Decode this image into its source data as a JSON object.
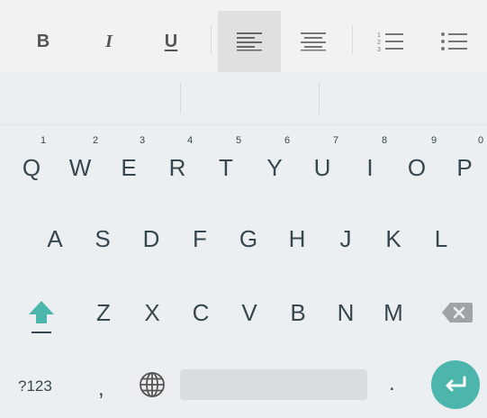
{
  "toolbar": {
    "bold_label": "B",
    "italic_label": "I",
    "underline_label": "U",
    "active_align": "left",
    "accent_active_bg": "#E0E0E0"
  },
  "suggestions": [
    "",
    "",
    ""
  ],
  "keyboard": {
    "row1": [
      {
        "key": "Q",
        "hint": "1"
      },
      {
        "key": "W",
        "hint": "2"
      },
      {
        "key": "E",
        "hint": "3"
      },
      {
        "key": "R",
        "hint": "4"
      },
      {
        "key": "T",
        "hint": "5"
      },
      {
        "key": "Y",
        "hint": "6"
      },
      {
        "key": "U",
        "hint": "7"
      },
      {
        "key": "I",
        "hint": "8"
      },
      {
        "key": "O",
        "hint": "9"
      },
      {
        "key": "P",
        "hint": "0"
      }
    ],
    "row2": [
      "A",
      "S",
      "D",
      "F",
      "G",
      "H",
      "J",
      "K",
      "L"
    ],
    "row3": [
      "Z",
      "X",
      "C",
      "V",
      "B",
      "N",
      "M"
    ],
    "symbols_label": "?123",
    "comma_label": ",",
    "period_label": ".",
    "accent_color": "#4DB6AC",
    "key_text_color": "#37474F"
  }
}
